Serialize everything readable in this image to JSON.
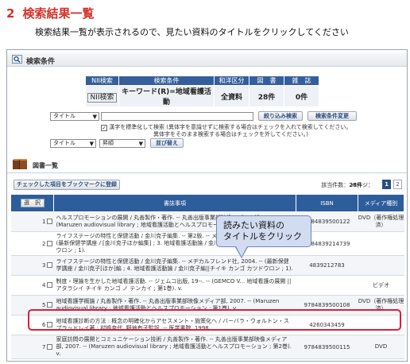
{
  "step": {
    "number": "2",
    "title": "検索結果一覧",
    "description": "検索結果一覧が表示されるので、見たい資料のタイトルをクリックしてください"
  },
  "search_conditions": {
    "section_title": "検索条件",
    "headers": [
      "NII検索",
      "検索条件",
      "和洋区分",
      "図　書",
      "雑　誌"
    ],
    "row": [
      "NII検索",
      "キーワード(R)=地域看護活動",
      "全資料",
      "28件",
      "0件"
    ],
    "field_select": "タイトル",
    "narrow_button": "絞り込み検索",
    "change_button": "検索条件変更",
    "checkbox_label": "漢字を標準化して検索 (異体字を意識せずに検索する場合はチェックを入れて検索してください。",
    "checkbox_note": "異体字をそのまま検索する場合はチェックを外してください。)",
    "sort_field": "タイトル",
    "sort_order": "昇順",
    "sort_button": "並び替え"
  },
  "book_list": {
    "section_title": "図書一覧",
    "bookmark_button": "チェックした項目をブックマークに登録",
    "count_label": "該当件数：",
    "count_value": "28件",
    "page_label": "ページ：",
    "pages": [
      "1",
      "2"
    ],
    "columns": {
      "select": "選　択",
      "bib": "書誌事項",
      "isbn": "ISBN",
      "media": "メディア種別"
    },
    "rows": [
      {
        "idx": "1",
        "bib": "ヘルスプロモーションの展開 / 丸善製作・著作. -- 丸善出版事業部映像メディア部, 2007. -- (Maruzen audiovisual library ; 地域看護活動とヘルスプロモーション ; 第3巻). v.",
        "isbn": "9784839500122",
        "media": "DVD（著作権処理済）"
      },
      {
        "idx": "2",
        "bib": "ライフステージの特性と保健活動 / 金川克子編集. -- 第2版. -- メヂカルフレンド社, 2008. -- (最新保健学講座 / [金川克子ほか編集] ; 3. 地域看護活動論 / 金川克子編||チイキ カンゴ カツドウロン ; 1).",
        "isbn": "9784839214739",
        "media": ""
      },
      {
        "idx": "3",
        "bib": "ライフステージの特性と保健活動 / 金川克子編集. -- メヂカルフレンド社, 2004. -- (最新保健学講座 / 金川克子[ほか]編 ; 4. 地域看護活動論 / 金川克子編||チイキ カンゴ カツドウロン ; 1).",
        "isbn": "4839212783",
        "media": ""
      },
      {
        "idx": "4",
        "bib": "制度・理論を生かした地域看護活動. -- ジェムコ出版, 19--. -- (GEMCO V... 地域看護の展開 || アタラシイ チイキ カンゴ ノ テンカイ ; 第1巻). v.",
        "isbn": "",
        "media": "ビデオ"
      },
      {
        "idx": "5",
        "bib": "地域看護学概論 / 丸善製作・著作. -- 丸善出版事業部映像メディア部, 2007. -- (Maruzen audiovisual library ; 地域看護活動とヘルスプロモーション ; 第1巻). v.",
        "isbn": "9784839500108",
        "media": "DVD（著作権処理済）"
      },
      {
        "idx": "6",
        "bib": "地域看護診断の方法 : 概念の明確化からアセスメント・施策化へ / バーバラ・ウォルトン・スプラッドレイ著 ; 村嶋幸代, 野地有子監訳. -- 医学書院, 1998.",
        "isbn": "4260343459",
        "media": ""
      },
      {
        "idx": "7",
        "bib": "家庭訪問の展開とコミュニケーション技術 / 丸善製作・著作. -- 丸善出版事業部映像メディア部, 2007. -- (Maruzen audiovisual library ; 地域看護活動とヘルスプロモーション ; 第2巻). v.",
        "isbn": "9784839500115",
        "media": "DVD"
      }
    ]
  },
  "callout": {
    "line1": "読みたい資料の",
    "line2": "タイトルをクリック"
  },
  "colors": {
    "heading": "#d2332b",
    "header_blue": "#2e5d9b",
    "highlight": "#d8203a",
    "callout_fill": "#d2dcf0"
  }
}
